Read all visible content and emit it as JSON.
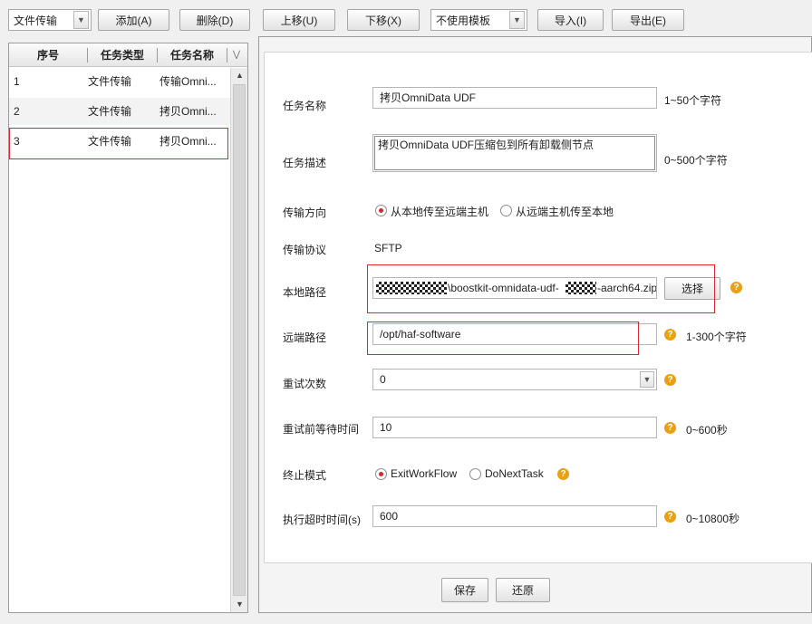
{
  "toolbar": {
    "task_type_select": "文件传输",
    "add_label": "添加(A)",
    "delete_label": "删除(D)",
    "move_up_label": "上移(U)",
    "move_down_label": "下移(X)",
    "template_select": "不使用模板",
    "import_label": "导入(I)",
    "export_label": "导出(E)"
  },
  "task_list": {
    "columns": [
      "序号",
      "任务类型",
      "任务名称"
    ],
    "rows": [
      {
        "index": "1",
        "type": "文件传输",
        "name": "传输Omni..."
      },
      {
        "index": "2",
        "type": "文件传输",
        "name": "拷贝Omni..."
      },
      {
        "index": "3",
        "type": "文件传输",
        "name": "拷贝Omni..."
      }
    ]
  },
  "form": {
    "task_name": {
      "label": "任务名称",
      "value": "拷贝OmniData UDF",
      "hint": "1~50个字符"
    },
    "task_desc": {
      "label": "任务描述",
      "value": "拷贝OmniData UDF压缩包到所有卸载侧节点",
      "hint": "0~500个字符"
    },
    "direction": {
      "label": "传输方向",
      "option1": "从本地传至远端主机",
      "option2": "从远端主机传至本地",
      "selected": "option1"
    },
    "protocol": {
      "label": "传输协议",
      "value": "SFTP"
    },
    "local_path": {
      "label": "本地路径",
      "value_part1": "\\boostkit-omnidata-udf-",
      "value_part2": "-aarch64.zip",
      "choose_label": "选择"
    },
    "remote_path": {
      "label": "远端路径",
      "value": "/opt/haf-software",
      "hint": "1-300个字符"
    },
    "retry_count": {
      "label": "重试次数",
      "value": "0"
    },
    "retry_wait": {
      "label": "重试前等待时间",
      "value": "10",
      "hint": "0~600秒"
    },
    "stop_mode": {
      "label": "终止模式",
      "option1": "ExitWorkFlow",
      "option2": "DoNextTask",
      "selected": "option1"
    },
    "timeout": {
      "label": "执行超时时间(s)",
      "value": "600",
      "hint": "0~10800秒"
    }
  },
  "footer": {
    "save_label": "保存",
    "restore_label": "还原"
  },
  "icons": {
    "help": "help-icon",
    "dropdown": "chevron-down-icon",
    "scroll": "scroll-arrow-icon"
  },
  "colors": {
    "annotation_red": "#e0252b",
    "help_orange": "#e8a016",
    "radio_selected": "#d2282f"
  }
}
